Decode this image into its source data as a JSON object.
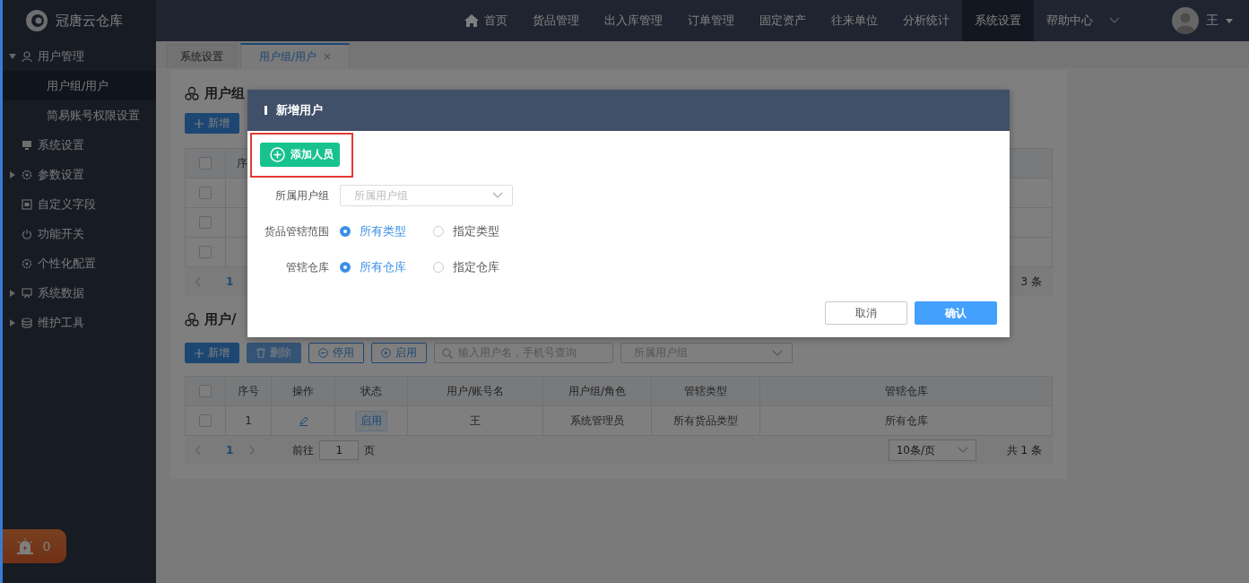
{
  "app": {
    "logo_text": "冠唐云仓库"
  },
  "top_nav": [
    {
      "label": "首页",
      "kind": "home",
      "selected": false
    },
    {
      "label": "货品管理",
      "kind": "plain",
      "selected": false
    },
    {
      "label": "出入库管理",
      "kind": "plain",
      "selected": false
    },
    {
      "label": "订单管理",
      "kind": "plain",
      "selected": false
    },
    {
      "label": "固定资产",
      "kind": "plain",
      "selected": false
    },
    {
      "label": "往来单位",
      "kind": "plain",
      "selected": false
    },
    {
      "label": "分析统计",
      "kind": "plain",
      "selected": false
    },
    {
      "label": "系统设置",
      "kind": "plain",
      "selected": true
    },
    {
      "label": "帮助中心",
      "kind": "dropdown",
      "selected": false
    }
  ],
  "user": {
    "name": "王"
  },
  "sidebar": [
    {
      "label": "用户管理",
      "expanded": true,
      "children": [
        {
          "label": "用户组/用户",
          "selected": true
        },
        {
          "label": "简易账号权限设置",
          "selected": false
        }
      ]
    },
    {
      "label": "系统设置"
    },
    {
      "label": "参数设置",
      "expanded": false
    },
    {
      "label": "自定义字段"
    },
    {
      "label": "功能开关"
    },
    {
      "label": "个性化配置"
    },
    {
      "label": "系统数据",
      "expanded": false
    },
    {
      "label": "维护工具",
      "expanded": false
    }
  ],
  "alarm": {
    "count": "0"
  },
  "tabs": [
    {
      "label": "系统设置",
      "selected": false,
      "closable": false
    },
    {
      "label": "用户组/用户",
      "selected": true,
      "closable": true
    }
  ],
  "group_section": {
    "title": "用户组",
    "add_button": "新增",
    "table": {
      "select_all": {
        "checked": false
      },
      "columns": [
        "序"
      ],
      "rows": [
        {
          "checked": false
        },
        {
          "checked": false
        },
        {
          "checked": false
        }
      ]
    },
    "pagination": {
      "page": "1",
      "total": "3 条"
    }
  },
  "user_section": {
    "title": "用户/",
    "toolbar": [
      {
        "label": "新增",
        "kind": "primary"
      },
      {
        "label": "删除",
        "kind": "disabled"
      },
      {
        "label": "停用",
        "kind": "stop"
      },
      {
        "label": "启用",
        "kind": "start"
      }
    ],
    "search": {
      "placeholder": "输入用户名，手机号查询"
    },
    "group_select": {
      "placeholder": "所属用户组"
    },
    "table": {
      "select_all": {
        "checked": false
      },
      "columns": [
        "序号",
        "操作",
        "状态",
        "用户/账号名",
        "用户组/角色",
        "管辖类型",
        "管辖仓库"
      ],
      "rows": [
        {
          "checked": false,
          "index": "1",
          "status": "启用",
          "name": "王",
          "group": "系统管理员",
          "goods_scope": "所有货品类型",
          "warehouse": "所有仓库"
        }
      ]
    },
    "pagination": {
      "page": "1",
      "goto_label": "前往",
      "goto_value": "1",
      "page_unit": "页",
      "page_size": "10条/页",
      "total": "共 1 条"
    }
  },
  "dialog": {
    "title": "新增用户",
    "add_button": "添加人员",
    "highlighted": true,
    "fields": [
      {
        "kind": "select",
        "label": "所属用户组",
        "placeholder": "所属用户组"
      },
      {
        "kind": "radio",
        "label": "货品管辖范围",
        "options": [
          {
            "label": "所有类型",
            "selected": true
          },
          {
            "label": "指定类型",
            "selected": false
          }
        ]
      },
      {
        "kind": "radio",
        "label": "管辖仓库",
        "options": [
          {
            "label": "所有仓库",
            "selected": true
          },
          {
            "label": "指定仓库",
            "selected": false
          }
        ]
      }
    ],
    "buttons": [
      {
        "label": "取消",
        "kind": "secondary"
      },
      {
        "label": "确认",
        "kind": "primary"
      }
    ]
  }
}
